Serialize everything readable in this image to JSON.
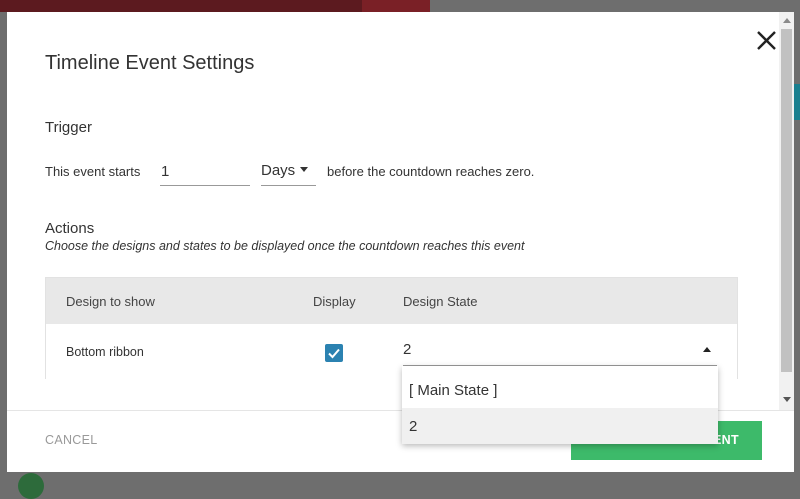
{
  "modal": {
    "title": "Timeline Event Settings"
  },
  "trigger": {
    "heading": "Trigger",
    "prefix": "This event starts",
    "value": "1",
    "unit": "Days",
    "suffix": "before the countdown reaches zero."
  },
  "actions": {
    "heading": "Actions",
    "subtitle": "Choose the designs and states to be displayed once the countdown reaches this event",
    "table": {
      "headers": [
        "Design to show",
        "Display",
        "Design State"
      ],
      "rows": [
        {
          "design": "Bottom ribbon",
          "display": true,
          "state": "2"
        }
      ]
    }
  },
  "dropdown": {
    "options": [
      "[ Main State ]",
      "2"
    ],
    "highlighted": "2"
  },
  "footer": {
    "cancel_label": "CANCEL",
    "save_label_visible": "ENT"
  },
  "colors": {
    "accent_green": "#3dba6a",
    "checkbox_blue": "#2b82b1",
    "header_gray": "#e8e8e8"
  }
}
